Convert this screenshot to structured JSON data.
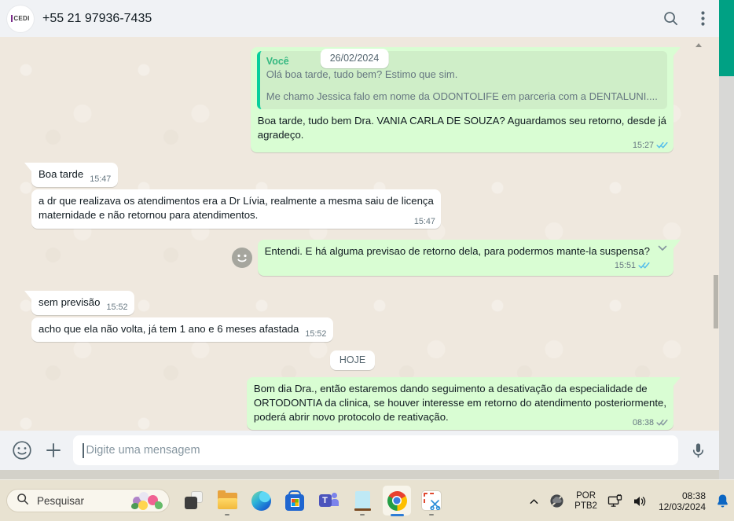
{
  "window": {
    "header": {
      "contact_name": "+55 21 97936-7435",
      "avatar_text": "CEDI"
    },
    "chat": {
      "sticky_date": "26/02/2024",
      "today_label": "HOJE",
      "messages": [
        {
          "direction": "out",
          "quote": {
            "sender": "Você",
            "line1": "Olá boa tarde, tudo bem? Estimo que sim.",
            "line2": "Me chamo Jessica falo em nome da ODONTOLIFE em parceria com a DENTALUNI...."
          },
          "lines": [
            "Boa tarde, tudo bem Dra. VANIA CARLA DE SOUZA? Aguardamos seu retorno, desde já",
            "agradeço."
          ],
          "time": "15:27",
          "status": "read"
        },
        {
          "direction": "in",
          "text": "Boa tarde",
          "time": "15:47"
        },
        {
          "direction": "in",
          "lines": [
            "a dr que realizava os atendimentos era a Dr Lívia, realmente a mesma saiu de licença",
            "maternidade e não retornou para atendimentos."
          ],
          "time": "15:47"
        },
        {
          "direction": "out",
          "text": "Entendi. E há alguma previsao de retorno dela, para podermos mante-la suspensa?",
          "time": "15:51",
          "status": "read"
        },
        {
          "direction": "in",
          "text": "sem previsão",
          "time": "15:52"
        },
        {
          "direction": "in",
          "text": "acho que ela não volta, já tem 1 ano e 6 meses afastada",
          "time": "15:52"
        },
        {
          "direction": "out",
          "lines": [
            "Bom dia Dra., então estaremos dando seguimento a desativação da especialidade de",
            "ORTODONTIA da clinica, se houver interesse em retorno do atendimento posteriormente,",
            "poderá abrir novo protocolo de reativação."
          ],
          "time": "08:38",
          "status": "delivered"
        }
      ]
    },
    "composer": {
      "placeholder": "Digite uma mensagem"
    }
  },
  "taskbar": {
    "search_placeholder": "Pesquisar",
    "tray": {
      "language": "POR",
      "layout": "PTB2",
      "time": "08:38",
      "date": "12/03/2024"
    }
  },
  "colors": {
    "outgoing_bubble": "#d9fdd3",
    "incoming_bubble": "#ffffff",
    "quote_accent": "#06cf9c",
    "tick_read": "#53bdeb",
    "tick_delivered": "#8696a0",
    "chat_background": "#efe8de",
    "header_background": "#f0f2f5",
    "green_strip": "#00a184",
    "taskbar_bell": "#0b66c3"
  }
}
